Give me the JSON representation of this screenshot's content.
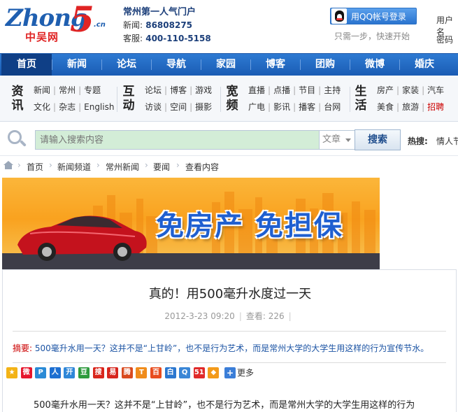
{
  "header": {
    "logo": {
      "word": "Zhong",
      "five": "5",
      "cn": ".cn",
      "sub": "中吴网"
    },
    "slogan": "常州第一人气门户",
    "news_label": "新闻:",
    "news_phone": "86808275",
    "service_label": "客服:",
    "service_phone": "400-110-5158",
    "qq_login": "用QQ帐号登录",
    "qq_hint": "只需一步，快速开始",
    "user_label": "用户名",
    "password_label": "密码"
  },
  "nav": {
    "items": [
      "首页",
      "新闻",
      "论坛",
      "导航",
      "家园",
      "博客",
      "团购",
      "微博",
      "婚庆"
    ],
    "active_index": 0
  },
  "subnav": {
    "groups": [
      {
        "title": [
          "资",
          "讯"
        ],
        "line1": [
          "新闻",
          "常州",
          "专题"
        ],
        "line2": [
          "文化",
          "杂志",
          "English"
        ]
      },
      {
        "title": [
          "互",
          "动"
        ],
        "line1": [
          "论坛",
          "博客",
          "游戏"
        ],
        "line2": [
          "访谈",
          "空间",
          "摄影"
        ]
      },
      {
        "title": [
          "宽",
          "频"
        ],
        "line1": [
          "直播",
          "点播",
          "节目",
          "主持"
        ],
        "line2": [
          "广电",
          "影讯",
          "播客",
          "台网"
        ]
      },
      {
        "title": [
          "生",
          "活"
        ],
        "line1": [
          "房产",
          "家装",
          "汽车"
        ],
        "line2": [
          "美食",
          "旅游",
          "招聘"
        ]
      }
    ],
    "highlight": "招聘"
  },
  "search": {
    "placeholder": "请输入搜索内容",
    "type": "文章",
    "button": "搜索",
    "hot_label": "热搜:",
    "hot_item": "情人节"
  },
  "breadcrumb": [
    "首页",
    "新闻频道",
    "常州新闻",
    "要闻",
    "查看内容"
  ],
  "banner": {
    "text": "免房产 免担保"
  },
  "article": {
    "title": "真的！用500毫升水度过一天",
    "date": "2012-3-23 09:20",
    "views_label": "查看:",
    "views": "226",
    "summary_label": "摘要:",
    "summary": "500毫升水用一天？这并不是“上甘岭”，也不是行为艺术，而是常州大学的大学生用这样的行为宣传节水。",
    "share_more": "更多",
    "body_first_line": "500毫升水用一天？这并不是“上甘岭”，也不是行为艺术，而是常州大学的大学生用这样的行为"
  },
  "share_icons": [
    {
      "name": "qzone-icon",
      "color": "#f3b316",
      "glyph": "★"
    },
    {
      "name": "weibo-icon",
      "color": "#e6162d",
      "glyph": "微"
    },
    {
      "name": "pengyou-icon",
      "color": "#2a8ad6",
      "glyph": "P"
    },
    {
      "name": "renren-icon",
      "color": "#1d6fd1",
      "glyph": "人"
    },
    {
      "name": "kaixin-icon",
      "color": "#2f87d8",
      "glyph": "开"
    },
    {
      "name": "douban-icon",
      "color": "#2e9b3d",
      "glyph": "豆"
    },
    {
      "name": "sohu-icon",
      "color": "#d9261c",
      "glyph": "搜"
    },
    {
      "name": "netease-icon",
      "color": "#d7261e",
      "glyph": "易"
    },
    {
      "name": "tqq-icon",
      "color": "#d94a1e",
      "glyph": "腾"
    },
    {
      "name": "tianya-icon",
      "color": "#f08c1b",
      "glyph": "T"
    },
    {
      "name": "baidu-icon",
      "color": "#e84c1e",
      "glyph": "百"
    },
    {
      "name": "baishehui-icon",
      "color": "#2b77cf",
      "glyph": "白"
    },
    {
      "name": "qq-friend-icon",
      "color": "#3a86d6",
      "glyph": "Q"
    },
    {
      "name": "51-icon",
      "color": "#e02a2a",
      "glyph": "51"
    },
    {
      "name": "fav-icon",
      "color": "#f39a1a",
      "glyph": "◆"
    }
  ]
}
